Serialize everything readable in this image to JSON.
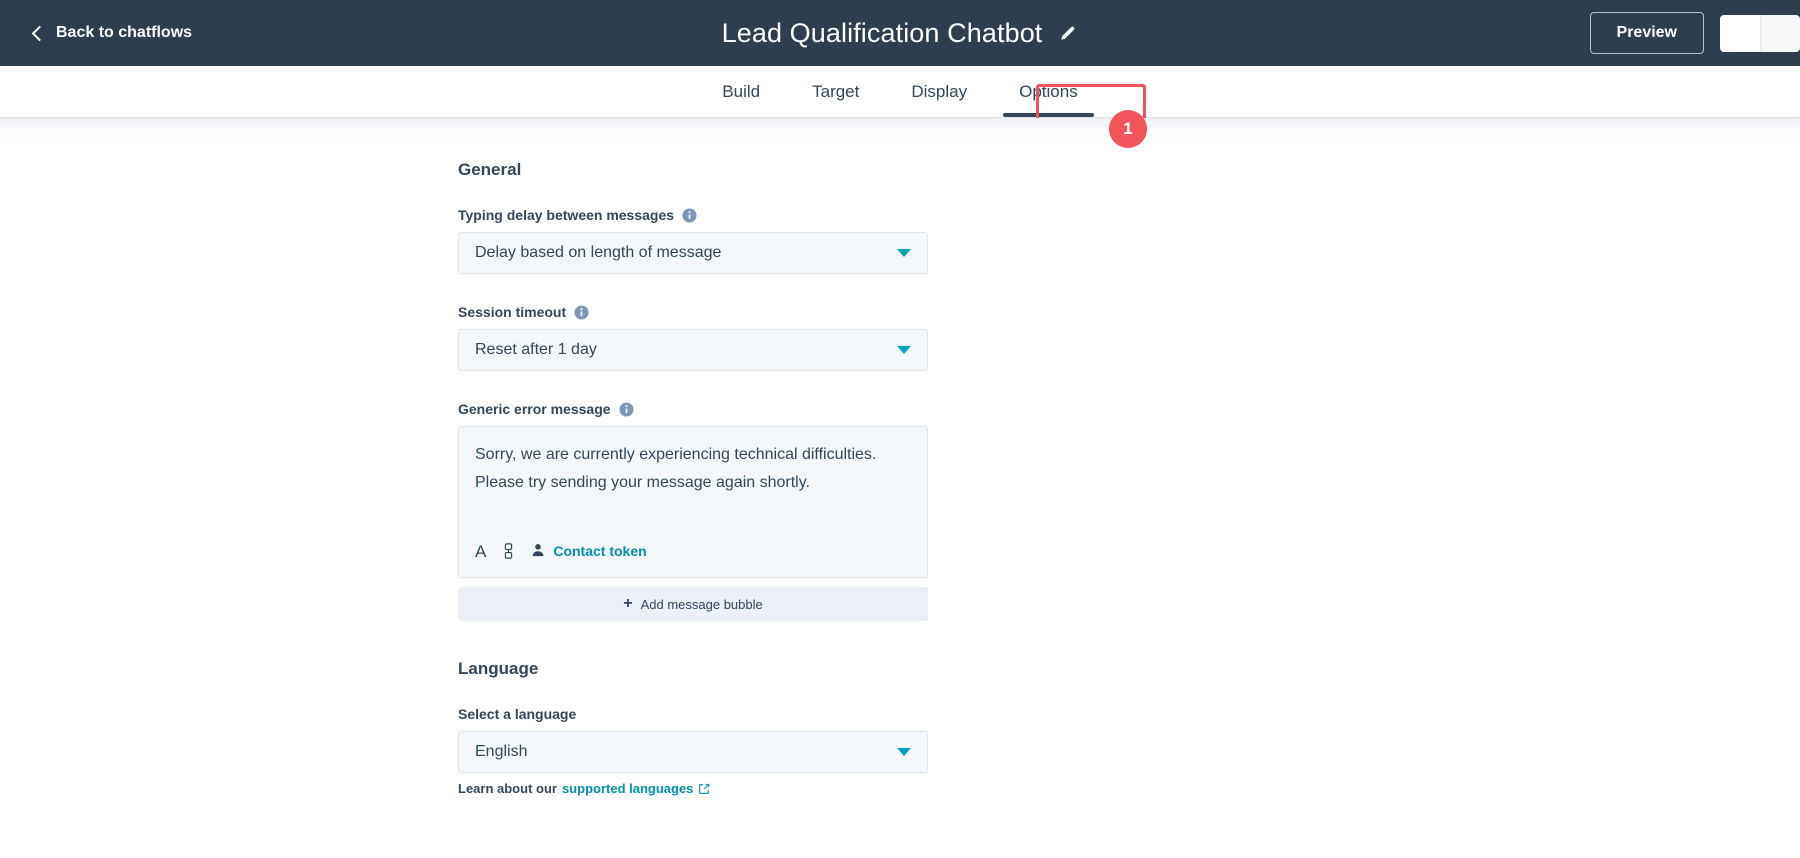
{
  "header": {
    "back_label": "Back to chatflows",
    "back_icon": "chevron-left-icon",
    "title": "Lead Qualification Chatbot",
    "edit_icon": "pencil-icon",
    "preview_label": "Preview",
    "accent_dark": "#2e3e4e"
  },
  "tabs": {
    "items": [
      {
        "label": "Build",
        "active": false
      },
      {
        "label": "Target",
        "active": false
      },
      {
        "label": "Display",
        "active": false
      },
      {
        "label": "Options",
        "active": true
      }
    ],
    "annotation": {
      "badge": "1",
      "color": "#f2545b",
      "target": "Options"
    }
  },
  "general": {
    "section_title": "General",
    "typing_delay": {
      "label": "Typing delay between messages",
      "info_icon": "info-icon",
      "value": "Delay based on length of message",
      "caret_icon": "chevron-down-icon"
    },
    "session_timeout": {
      "label": "Session timeout",
      "info_icon": "info-icon",
      "value": "Reset after 1 day",
      "caret_icon": "chevron-down-icon"
    },
    "error_message": {
      "label": "Generic error message",
      "info_icon": "info-icon",
      "value": "Sorry, we are currently experiencing technical difficulties. Please try sending your message again shortly.",
      "toolbar": {
        "format_icon": "text-format-icon",
        "format_label": "A",
        "link_icon": "link-icon",
        "token_icon": "contact-person-icon",
        "token_label": "Contact token"
      },
      "add_bubble_label": "Add message bubble",
      "add_bubble_icon": "plus-icon"
    }
  },
  "language": {
    "section_title": "Language",
    "select_label": "Select a language",
    "value": "English",
    "caret_icon": "chevron-down-icon",
    "helper_prefix": "Learn about our",
    "helper_link": "supported languages",
    "external_icon": "external-link-icon"
  },
  "colors": {
    "teal": "#00a4bd",
    "link": "#0091ae",
    "text": "#33475b",
    "field_bg": "#f5f8fa",
    "field_border": "#dfe3eb",
    "annotation_red": "#f2545b"
  }
}
